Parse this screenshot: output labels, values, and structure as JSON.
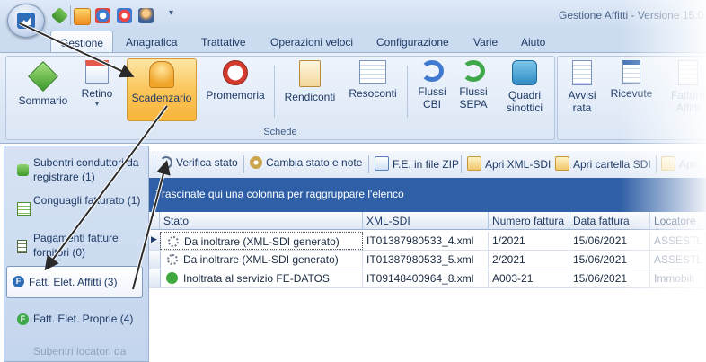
{
  "app": {
    "title": "Gestione Affitti - Versione 15.0"
  },
  "quick_access": {
    "icons": [
      "home-icon",
      "bell-icon",
      "refresh-icon",
      "help-icon",
      "user-icon"
    ],
    "menu_glyph": "▾"
  },
  "ribbon": {
    "tabs": [
      {
        "label": "Gestione",
        "active": true
      },
      {
        "label": "Anagrafica"
      },
      {
        "label": "Trattative"
      },
      {
        "label": "Operazioni veloci"
      },
      {
        "label": "Configurazione"
      },
      {
        "label": "Varie"
      },
      {
        "label": "Aiuto"
      }
    ],
    "group_label": "Schede",
    "buttons": [
      {
        "label": "Sommario",
        "icon": "diamond-icon"
      },
      {
        "label": "Retino",
        "icon": "calendar-icon"
      },
      {
        "label": "Scadenzario",
        "icon": "bell-icon",
        "highlighted": true
      },
      {
        "label": "Promemoria",
        "icon": "alarm-clock-icon"
      },
      {
        "label": "Rendiconti",
        "icon": "clipboard-icon"
      },
      {
        "label": "Resoconti",
        "icon": "form-icon"
      },
      {
        "label": "Flussi CBI",
        "icon": "sync-blue-icon"
      },
      {
        "label": "Flussi SEPA",
        "icon": "sync-green-icon"
      },
      {
        "label": "Quadri sinottici",
        "icon": "puzzle-icon"
      },
      {
        "label": "Avvisi rata",
        "icon": "notice-icon"
      },
      {
        "label": "Ricevute",
        "icon": "receipt-icon"
      },
      {
        "label": "Fatture Affitti",
        "icon": "invoice-icon"
      }
    ]
  },
  "nav": {
    "items": [
      {
        "label": "Subentri conduttori da registrare (1)"
      },
      {
        "label": "Conguagli fatturato (1)"
      },
      {
        "label": "Pagamenti fatture fornitori (0)"
      },
      {
        "label": "Fatt. Elet. Affitti (3)",
        "selected": true,
        "badge": "F"
      },
      {
        "label": "Fatt. Elet. Proprie (4)",
        "badge": "F"
      },
      {
        "label": "Subentri locatori da"
      }
    ]
  },
  "toolbar": {
    "buttons": [
      {
        "label": "Verifica stato"
      },
      {
        "label": "Cambia stato e note"
      },
      {
        "label": "F.E. in file ZIP"
      },
      {
        "label": "Apri XML-SDI"
      },
      {
        "label": "Apri cartella SDI"
      },
      {
        "label": "Apri"
      }
    ]
  },
  "group_panel": {
    "text": "Trascinate qui una colonna per raggruppare l'elenco"
  },
  "grid": {
    "columns": [
      "Stato",
      "XML-SDI",
      "Numero fattura",
      "Data fattura",
      "Locatore"
    ],
    "rows": [
      {
        "stato": "Da inoltrare (XML-SDI generato)",
        "xml": "IT01387980533_4.xml",
        "numero": "1/2021",
        "data": "15/06/2021",
        "locatore": "ASSESTL",
        "icon": "gear-icon",
        "current": true
      },
      {
        "stato": "Da inoltrare (XML-SDI generato)",
        "xml": "IT01387980533_5.xml",
        "numero": "2/2021",
        "data": "15/06/2021",
        "locatore": "ASSESTL",
        "icon": "gear-icon"
      },
      {
        "stato": "Inoltrata al servizio FE-DATOS",
        "xml": "IT09148400964_8.xml",
        "numero": "A003-21",
        "data": "15/06/2021",
        "locatore": "Immobili",
        "icon": "check-globe-icon"
      }
    ]
  },
  "colors": {
    "accent": "#2f5fa6",
    "highlight": "#fbc65a",
    "ribbon": "#dbe6f5"
  }
}
